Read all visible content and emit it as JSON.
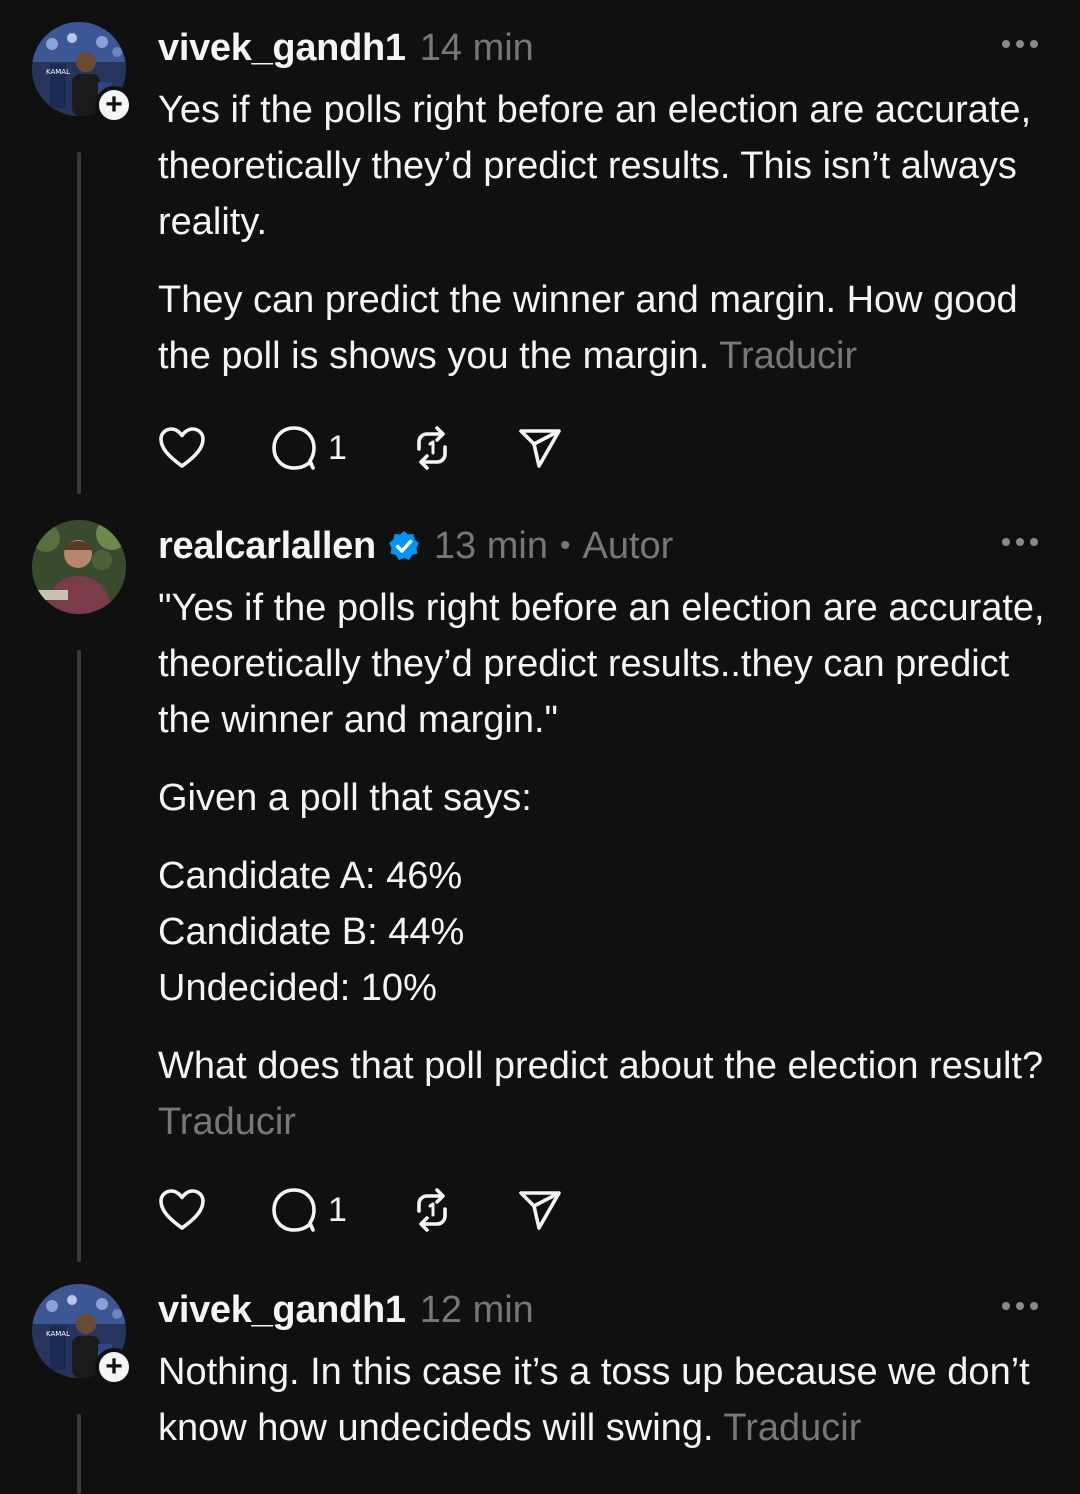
{
  "posts": [
    {
      "username": "vivek_gandh1",
      "time": "14 min",
      "paragraphs": [
        "Yes if the polls right before an election are accurate, theoretically they’d predict results. This isn’t always reality.",
        "They can predict the winner and margin. How good the poll is shows you the margin."
      ],
      "translate": "Traducir",
      "reply_count": "1",
      "avatar_text": "KAMAL"
    },
    {
      "username": "realcarlallen",
      "time": "13 min",
      "separator": "•",
      "author_label": "Autor",
      "paragraphs": [
        "\"Yes if the polls right before an election are accurate, theoretically they’d predict results..they can predict the winner and margin.\"",
        "Given a poll that says:"
      ],
      "poll_lines": [
        "Candidate A: 46%",
        "Candidate B: 44%",
        "Undecided: 10%"
      ],
      "closing": "What does that poll predict about the election result?",
      "translate": "Traducir",
      "reply_count": "1"
    },
    {
      "username": "vivek_gandh1",
      "time": "12 min",
      "paragraphs": [
        "Nothing. In this case it’s a toss up because we don’t know how undecideds will swing."
      ],
      "translate": "Traducir",
      "avatar_text": "KAMAL"
    }
  ],
  "icons": {
    "like": "heart-icon",
    "reply": "comment-icon",
    "repost": "repost-icon",
    "share": "send-icon",
    "verified": "verified-badge-icon",
    "more": "more-options-icon",
    "follow": "plus-icon"
  },
  "colors": {
    "background": "#101010",
    "text": "#f3f5f7",
    "muted": "#777777",
    "verified": "#0095f6"
  }
}
